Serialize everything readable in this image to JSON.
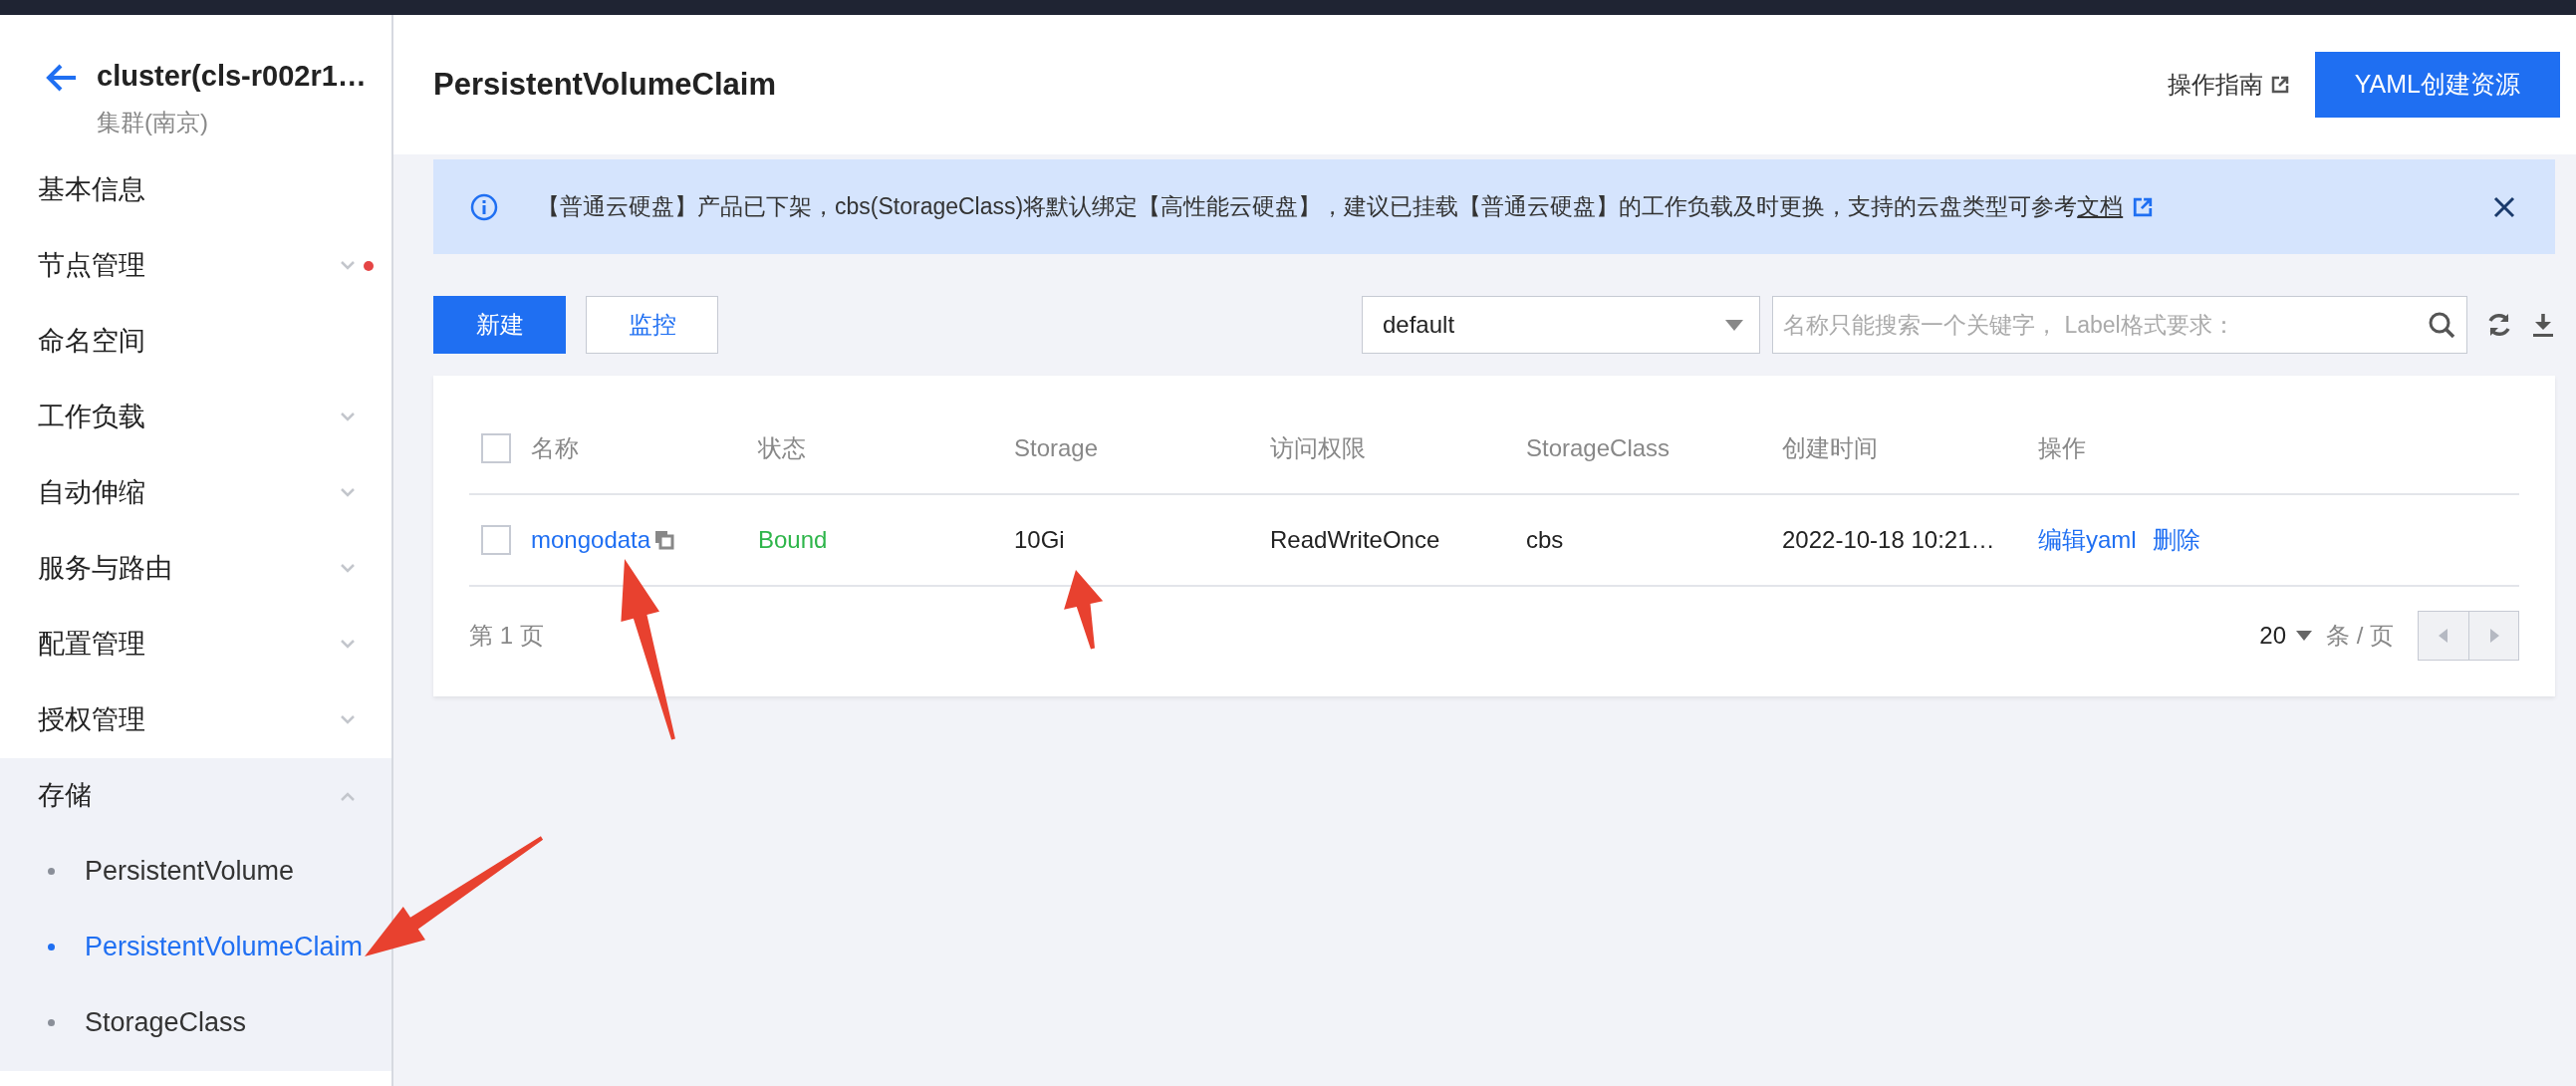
{
  "sidebar": {
    "title": "cluster(cls-r002r1…",
    "subtitle": "集群(南京)",
    "items": [
      {
        "label": "基本信息",
        "kind": "link",
        "alert": false
      },
      {
        "label": "节点管理",
        "kind": "group",
        "expanded": false,
        "alert": true
      },
      {
        "label": "命名空间",
        "kind": "link",
        "alert": false
      },
      {
        "label": "工作负载",
        "kind": "group",
        "expanded": false,
        "alert": false
      },
      {
        "label": "自动伸缩",
        "kind": "group",
        "expanded": false,
        "alert": false
      },
      {
        "label": "服务与路由",
        "kind": "group",
        "expanded": false,
        "alert": false
      },
      {
        "label": "配置管理",
        "kind": "group",
        "expanded": false,
        "alert": false
      },
      {
        "label": "授权管理",
        "kind": "group",
        "expanded": false,
        "alert": false
      },
      {
        "label": "存储",
        "kind": "group",
        "expanded": true,
        "alert": false,
        "children": [
          {
            "label": "PersistentVolume",
            "selected": false
          },
          {
            "label": "PersistentVolumeClaim",
            "selected": true
          },
          {
            "label": "StorageClass",
            "selected": false
          }
        ]
      }
    ]
  },
  "header": {
    "title": "PersistentVolumeClaim",
    "guide_link": "操作指南",
    "create_button": "YAML创建资源"
  },
  "notice": {
    "text": "【普通云硬盘】产品已下架，cbs(StorageClass)将默认绑定【高性能云硬盘】，建议已挂载【普通云硬盘】的工作负载及时更换，支持的云盘类型可参考",
    "link": "文档"
  },
  "toolbar": {
    "buttons": [
      {
        "label": "新建",
        "kind": "primary"
      },
      {
        "label": "监控",
        "kind": "default"
      }
    ],
    "namespace": "default",
    "search": {
      "placeholder": "名称只能搜索一个关键字， Label格式要求："
    }
  },
  "table": {
    "select_all": false,
    "columns": [
      "名称",
      "状态",
      "Storage",
      "访问权限",
      "StorageClass",
      "创建时间",
      "操作"
    ],
    "rows": [
      {
        "checked": false,
        "name": "mongodata",
        "status": "Bound",
        "storage": "10Gi",
        "access": "ReadWriteOnce",
        "storage_class": "cbs",
        "created": "2022-10-18 10:21…",
        "actions": [
          "编辑yaml",
          "删除"
        ]
      }
    ]
  },
  "pagination": {
    "page_label": "第 1 页",
    "page_size": "20",
    "per_page_label": "条 / 页"
  }
}
